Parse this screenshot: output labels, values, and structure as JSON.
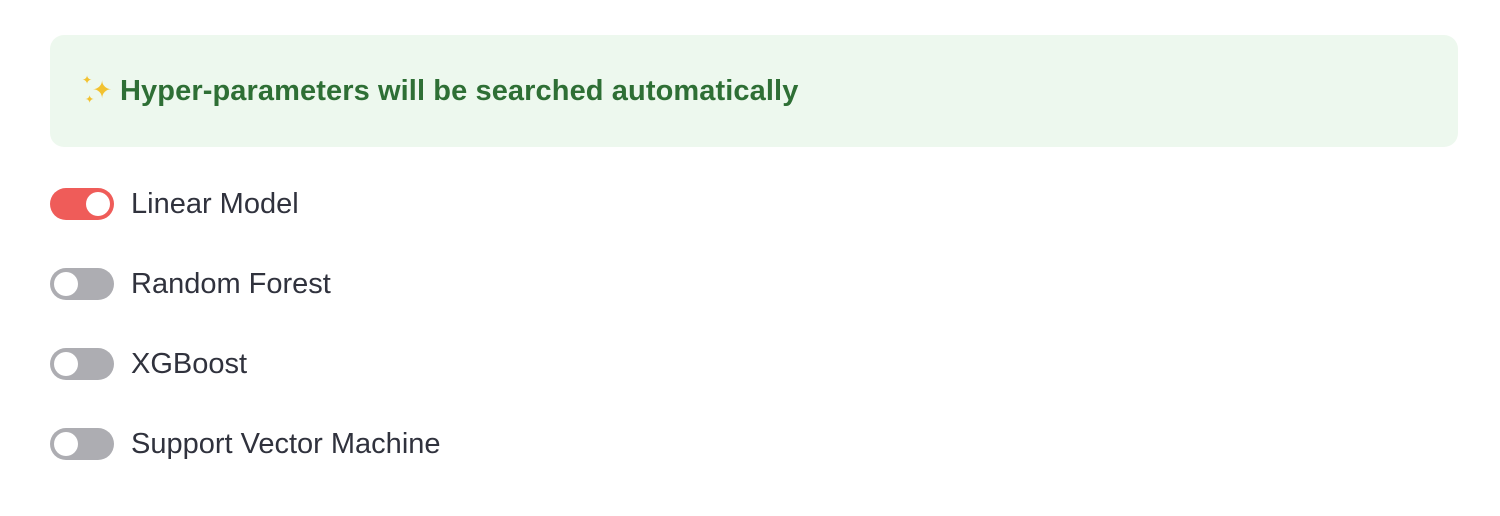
{
  "banner": {
    "icon": "sparkles-icon",
    "text": "Hyper-parameters will be searched automatically",
    "background": "#edf8ee",
    "text_color": "#2e6f35"
  },
  "colors": {
    "toggle_on": "#ef5c59",
    "toggle_off": "#adadb2"
  },
  "models": [
    {
      "label": "Linear Model",
      "enabled": true
    },
    {
      "label": "Random Forest",
      "enabled": false
    },
    {
      "label": "XGBoost",
      "enabled": false
    },
    {
      "label": "Support Vector Machine",
      "enabled": false
    }
  ]
}
